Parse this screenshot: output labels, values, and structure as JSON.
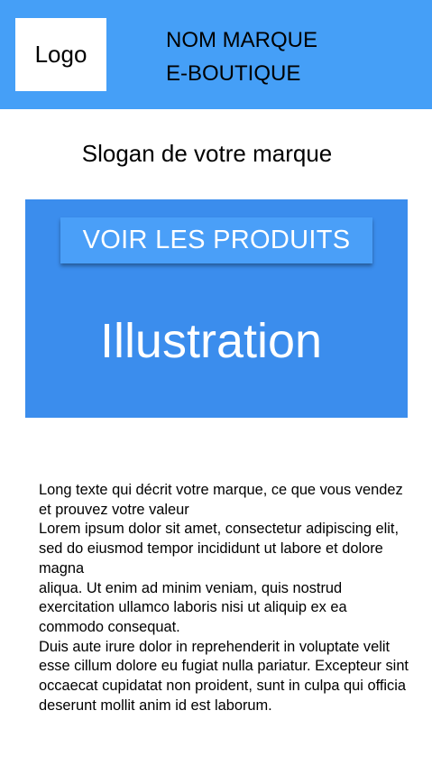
{
  "header": {
    "logo_label": "Logo",
    "brand_line1": "NOM MARQUE",
    "brand_line2": "E-BOUTIQUE",
    "background_color": "#459ff7"
  },
  "slogan": "Slogan de votre marque",
  "hero": {
    "cta_label": "VOIR LES PRODUITS",
    "illustration_label": "Illustration",
    "background_color": "#3b8ded"
  },
  "description": "Long texte qui décrit votre marque, ce que vous vendez et prouvez votre valeur\nLorem ipsum dolor sit amet, consectetur adipiscing elit, sed do eiusmod tempor incididunt ut labore et dolore magna\naliqua. Ut enim ad minim veniam, quis nostrud exercitation ullamco laboris nisi ut aliquip ex ea commodo consequat.\n Duis aute irure dolor in reprehenderit in voluptate velit esse cillum dolore eu fugiat nulla pariatur. Excepteur sint\noccaecat cupidatat non proident, sunt in culpa qui officia deserunt mollit anim id est laborum."
}
